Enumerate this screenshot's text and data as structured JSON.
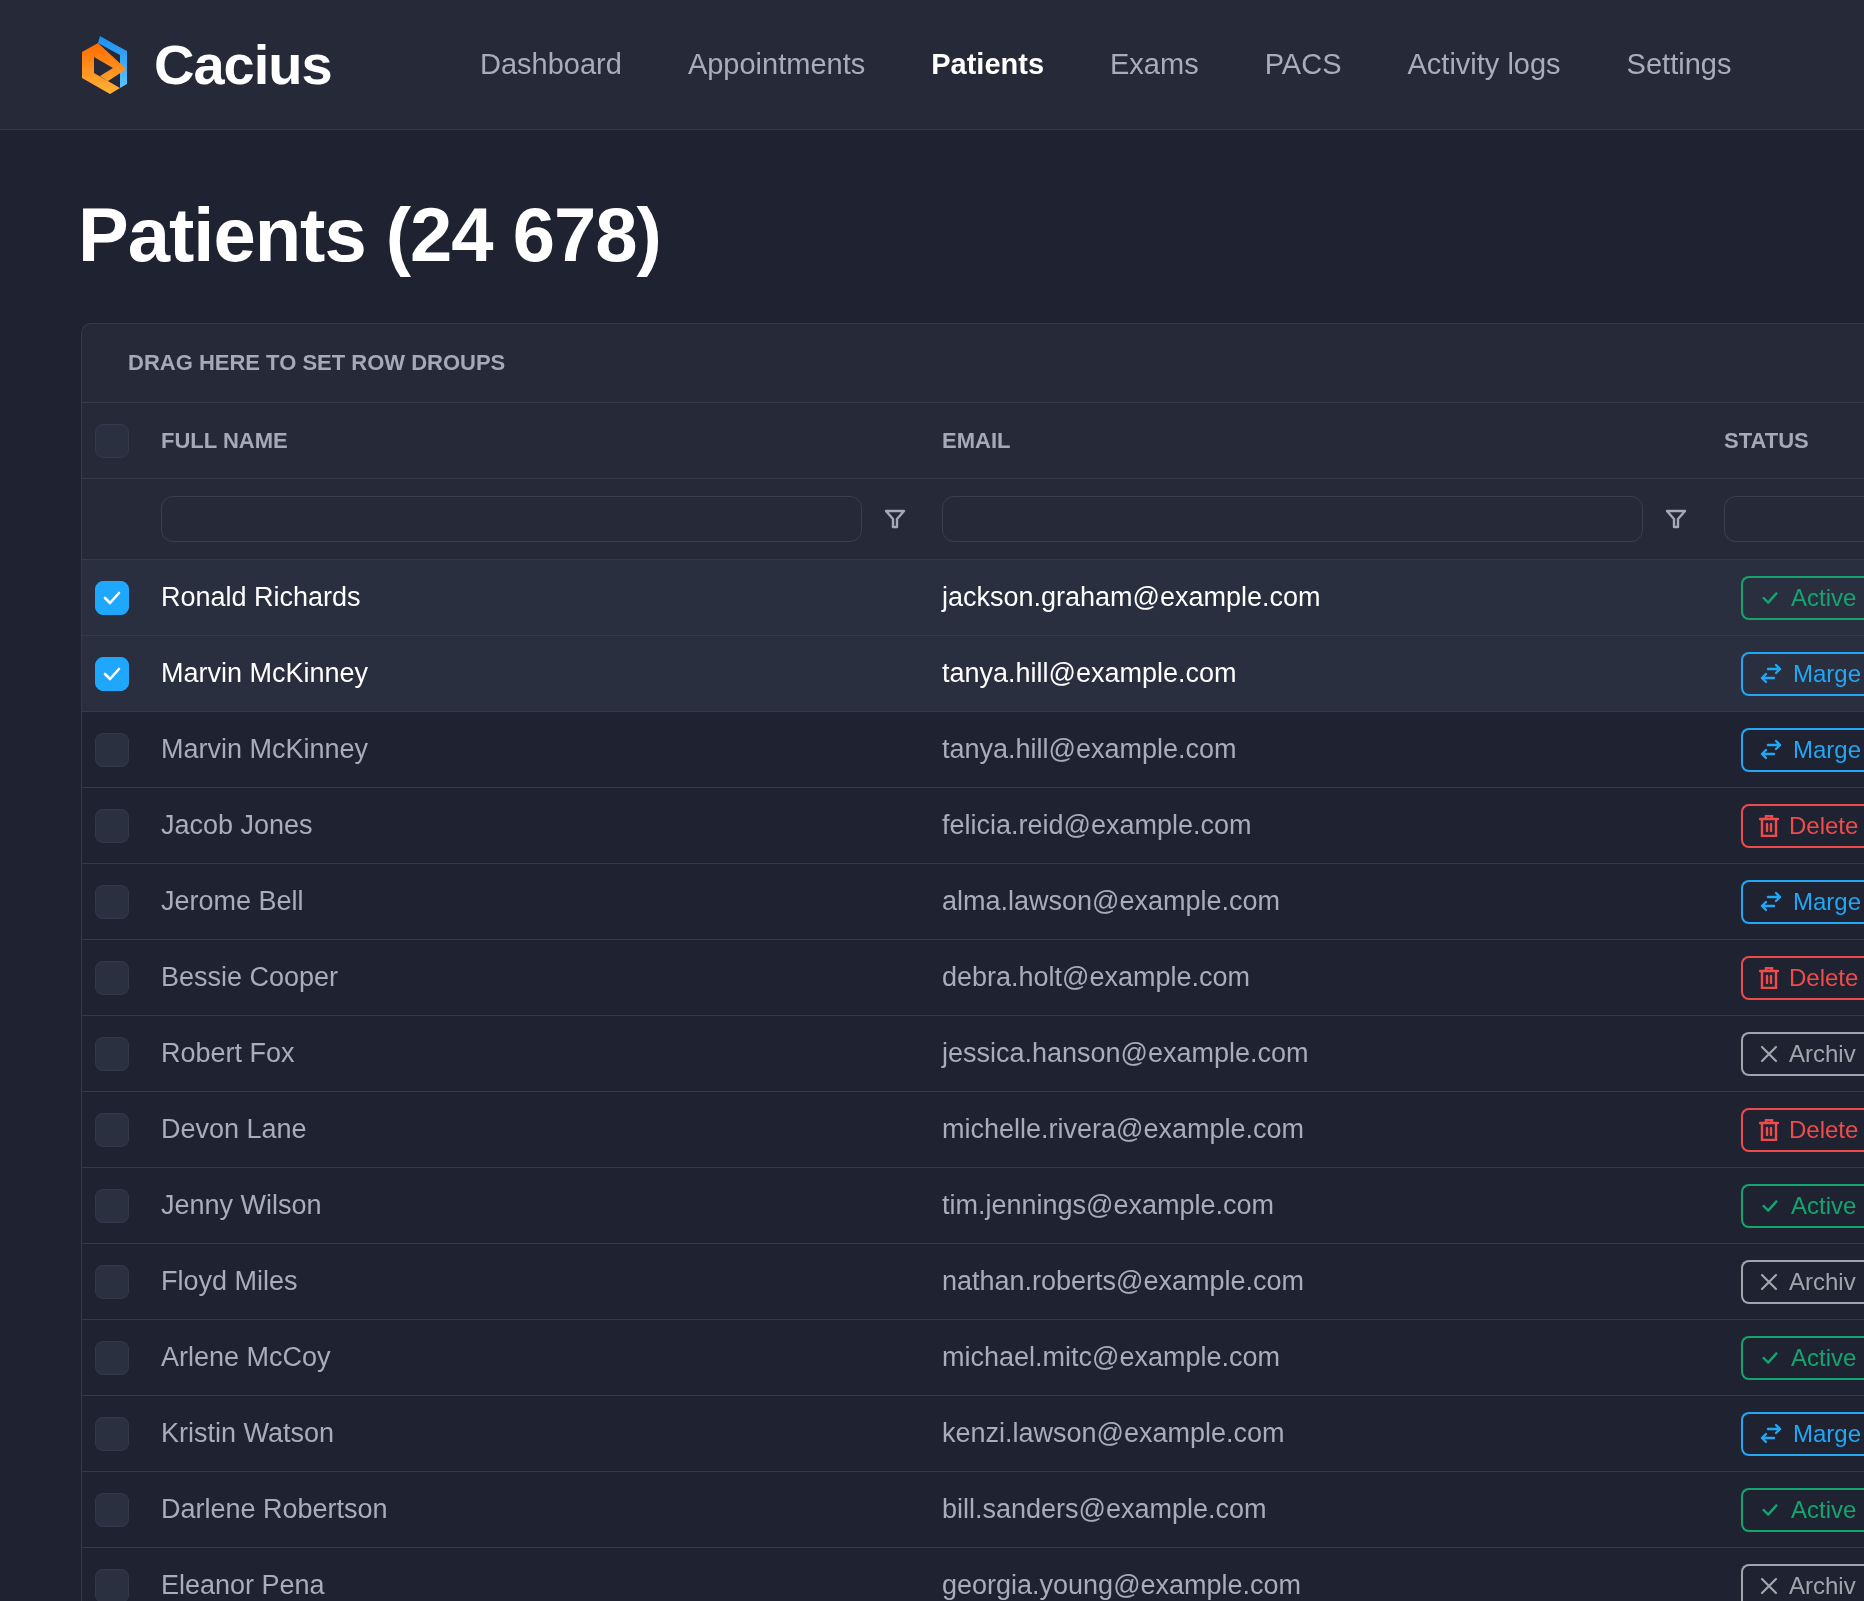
{
  "brand": {
    "name": "Cacius"
  },
  "nav": [
    {
      "label": "Dashboard",
      "selected": false
    },
    {
      "label": "Appointments",
      "selected": false
    },
    {
      "label": "Patients",
      "selected": true
    },
    {
      "label": "Exams",
      "selected": false
    },
    {
      "label": "PACS",
      "selected": false
    },
    {
      "label": "Activity logs",
      "selected": false
    },
    {
      "label": "Settings",
      "selected": false
    }
  ],
  "page_title": "Patients (24 678)",
  "grid": {
    "group_bar": "DRAG HERE TO SET ROW DROUPS",
    "select_all": {
      "checked": false
    },
    "columns": [
      {
        "label": "FULL NAME",
        "filter_icon": true
      },
      {
        "label": "EMAIL",
        "filter_icon": true
      },
      {
        "label": "STATUS",
        "filter_icon": false
      }
    ],
    "rows": [
      {
        "name": "Ronald Richards",
        "email": "jackson.graham@example.com",
        "status": {
          "kind": "active",
          "label": "Active"
        },
        "selected": true
      },
      {
        "name": "Marvin McKinney",
        "email": "tanya.hill@example.com",
        "status": {
          "kind": "merge",
          "label": "Marge"
        },
        "selected": true
      },
      {
        "name": "Marvin McKinney",
        "email": "tanya.hill@example.com",
        "status": {
          "kind": "merge",
          "label": "Marge"
        },
        "selected": false
      },
      {
        "name": "Jacob Jones",
        "email": "felicia.reid@example.com",
        "status": {
          "kind": "delete",
          "label": "Delete"
        },
        "selected": false
      },
      {
        "name": "Jerome Bell",
        "email": "alma.lawson@example.com",
        "status": {
          "kind": "merge",
          "label": "Marge"
        },
        "selected": false
      },
      {
        "name": "Bessie Cooper",
        "email": "debra.holt@example.com",
        "status": {
          "kind": "delete",
          "label": "Delete"
        },
        "selected": false
      },
      {
        "name": "Robert Fox",
        "email": "jessica.hanson@example.com",
        "status": {
          "kind": "archive",
          "label": "Archiv"
        },
        "selected": false
      },
      {
        "name": "Devon Lane",
        "email": "michelle.rivera@example.com",
        "status": {
          "kind": "delete",
          "label": "Delete"
        },
        "selected": false
      },
      {
        "name": "Jenny Wilson",
        "email": "tim.jennings@example.com",
        "status": {
          "kind": "active",
          "label": "Active"
        },
        "selected": false
      },
      {
        "name": "Floyd Miles",
        "email": "nathan.roberts@example.com",
        "status": {
          "kind": "archive",
          "label": "Archiv"
        },
        "selected": false
      },
      {
        "name": "Arlene McCoy",
        "email": "michael.mitc@example.com",
        "status": {
          "kind": "active",
          "label": "Active"
        },
        "selected": false
      },
      {
        "name": "Kristin Watson",
        "email": "kenzi.lawson@example.com",
        "status": {
          "kind": "merge",
          "label": "Marge"
        },
        "selected": false
      },
      {
        "name": "Darlene Robertson",
        "email": "bill.sanders@example.com",
        "status": {
          "kind": "active",
          "label": "Active"
        },
        "selected": false
      },
      {
        "name": "Eleanor Pena",
        "email": "georgia.young@example.com",
        "status": {
          "kind": "archive",
          "label": "Archiv"
        },
        "selected": false
      }
    ]
  }
}
